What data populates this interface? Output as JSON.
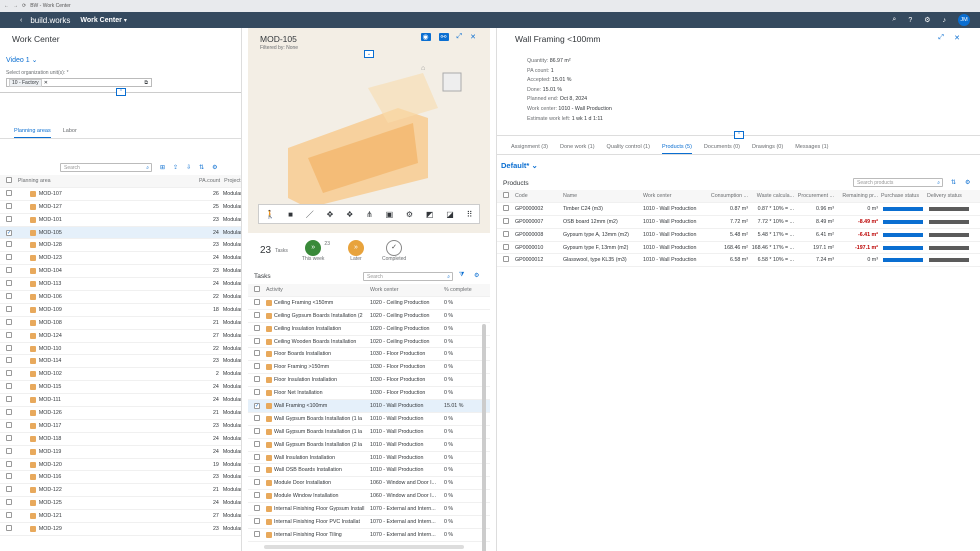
{
  "browser": {
    "tab": "BW - Work Center"
  },
  "shell": {
    "logo": "build.works",
    "app": "Work Center",
    "avatar": "JM"
  },
  "left": {
    "title": "Work Center",
    "variant": "Video 1",
    "org_label": "Select organization unit(s): *",
    "org_value": "10 - Factory",
    "tabs": [
      "Planning areas",
      "Labor"
    ],
    "search_ph": "Search",
    "cols": [
      "Planning area",
      "PA.count",
      "Project"
    ],
    "rows": [
      [
        "MOD-107",
        "26",
        "Modular"
      ],
      [
        "MOD-127",
        "25",
        "Modular"
      ],
      [
        "MOD-101",
        "23",
        "Modular"
      ],
      [
        "MOD-105",
        "24",
        "Modular"
      ],
      [
        "MOD-128",
        "23",
        "Modular"
      ],
      [
        "MOD-123",
        "24",
        "Modular"
      ],
      [
        "MOD-104",
        "23",
        "Modular"
      ],
      [
        "MOD-113",
        "24",
        "Modular"
      ],
      [
        "MOD-106",
        "22",
        "Modular"
      ],
      [
        "MOD-109",
        "18",
        "Modular"
      ],
      [
        "MOD-108",
        "21",
        "Modular"
      ],
      [
        "MOD-124",
        "27",
        "Modular"
      ],
      [
        "MOD-110",
        "22",
        "Modular"
      ],
      [
        "MOD-114",
        "23",
        "Modular"
      ],
      [
        "MOD-102",
        "2",
        "Modular"
      ],
      [
        "MOD-115",
        "24",
        "Modular"
      ],
      [
        "MOD-111",
        "24",
        "Modular"
      ],
      [
        "MOD-126",
        "21",
        "Modular"
      ],
      [
        "MOD-117",
        "23",
        "Modular"
      ],
      [
        "MOD-118",
        "24",
        "Modular"
      ],
      [
        "MOD-119",
        "24",
        "Modular"
      ],
      [
        "MOD-120",
        "19",
        "Modular"
      ],
      [
        "MOD-116",
        "23",
        "Modular"
      ],
      [
        "MOD-122",
        "21",
        "Modular"
      ],
      [
        "MOD-125",
        "24",
        "Modular"
      ],
      [
        "MOD-121",
        "27",
        "Modular"
      ],
      [
        "MOD-129",
        "23",
        "Modular"
      ]
    ]
  },
  "middle": {
    "title": "MOD-105",
    "filter": "Filtered by: None",
    "tasks_count": "23",
    "tasks_label": "Tasks",
    "this_week": "This week",
    "this_week_badge": "23",
    "later": "Later",
    "completed": "Completed",
    "tasks_title": "Tasks",
    "search_ph": "Search",
    "cols": [
      "Activity",
      "Work center",
      "% complete"
    ],
    "rows": [
      [
        "Ceiling Framing <150mm",
        "1020 - Ceiling Production",
        "0 %"
      ],
      [
        "Ceiling Gypsum Boards Installation (2",
        "1020 - Ceiling Production",
        "0 %"
      ],
      [
        "Ceiling Insulation Installation",
        "1020 - Ceiling Production",
        "0 %"
      ],
      [
        "Ceiling Wooden Boards Installation",
        "1020 - Ceiling Production",
        "0 %"
      ],
      [
        "Floor Boards Installation",
        "1030 - Floor Production",
        "0 %"
      ],
      [
        "Floor Framing >150mm",
        "1030 - Floor Production",
        "0 %"
      ],
      [
        "Floor Insulation Installation",
        "1030 - Floor Production",
        "0 %"
      ],
      [
        "Floor Net Installation",
        "1030 - Floor Production",
        "0 %"
      ],
      [
        "Wall Framing <100mm",
        "1010 - Wall Production",
        "15.01 %"
      ],
      [
        "Wall Gypsum Boards Installation (1 la",
        "1010 - Wall Production",
        "0 %"
      ],
      [
        "Wall Gypsum Boards Installation (1 la",
        "1010 - Wall Production",
        "0 %"
      ],
      [
        "Wall Gypsum Boards Installation (2 la",
        "1010 - Wall Production",
        "0 %"
      ],
      [
        "Wall Insulation Installation",
        "1010 - Wall Production",
        "0 %"
      ],
      [
        "Wall OSB Boards Installation",
        "1010 - Wall Production",
        "0 %"
      ],
      [
        "Module Door Installation",
        "1060 - Window and Door I...",
        "0 %"
      ],
      [
        "Module Window Installation",
        "1060 - Window and Door I...",
        "0 %"
      ],
      [
        "Internal Finishing Floor Gypsum Install",
        "1070 - External and Intern...",
        "0 %"
      ],
      [
        "Internal Finishing Floor PVC Installat",
        "1070 - External and Intern...",
        "0 %"
      ],
      [
        "Internal Finishing Floor Tiling",
        "1070 - External and Intern...",
        "0 %"
      ]
    ]
  },
  "right": {
    "title": "Wall Framing <100mm",
    "info": [
      [
        "Quantity:",
        "86.97 m²"
      ],
      [
        "PA count:",
        "1"
      ],
      [
        "Accepted:",
        "15.01 %"
      ],
      [
        "Done:",
        "15.01 %"
      ],
      [
        "Planned end:",
        "Oct 8, 2024"
      ],
      [
        "Work center:",
        "1010 - Wall Production"
      ],
      [
        "Estimate work left:",
        "1 wk 1 d 1:11"
      ]
    ],
    "tabs": [
      "Assignment (3)",
      "Done work (1)",
      "Quality control (1)",
      "Products (5)",
      "Documents (0)",
      "Drawings (0)",
      "Messages (1)"
    ],
    "variant": "Default*",
    "products_title": "Products",
    "search_ph": "Search products",
    "cols": [
      "Code",
      "Name",
      "Work center",
      "Consumption ...",
      "Waste calcula...",
      "Procurement ...",
      "Remaining pr...",
      "Purchase status",
      "Delivery status"
    ],
    "rows": [
      [
        "GP0000002",
        "Timber C24 (m3)",
        "1010 - Wall Production",
        "0.87 m³",
        "0.87 * 10% = ...",
        "0.96 m³",
        "0 m³"
      ],
      [
        "GP0000007",
        "OSB board 12mm (m2)",
        "1010 - Wall Production",
        "7.72 m²",
        "7.72 * 10% = ...",
        "8.49 m²",
        "-8.49 m²"
      ],
      [
        "GP0000008",
        "Gypsum type A, 13mm (m2)",
        "1010 - Wall Production",
        "5.48 m²",
        "5.48 * 17% = ...",
        "6.41 m²",
        "-6.41 m²"
      ],
      [
        "GP0000010",
        "Gypsum type F, 13mm (m2)",
        "1010 - Wall Production",
        "168.46 m²",
        "168.46 * 17% = ...",
        "197.1 m²",
        "-197.1 m²"
      ],
      [
        "GP0000012",
        "Glasswool, type KL35 (m3)",
        "1010 - Wall Production",
        "6.58 m³",
        "6.58 * 10% = ...",
        "7.24 m³",
        "0 m³"
      ]
    ],
    "purchase": [
      1.0,
      1.0,
      1.0,
      1.0,
      1.0
    ],
    "delivery": [
      1.0,
      1.0,
      1.0,
      1.0,
      1.0
    ]
  }
}
